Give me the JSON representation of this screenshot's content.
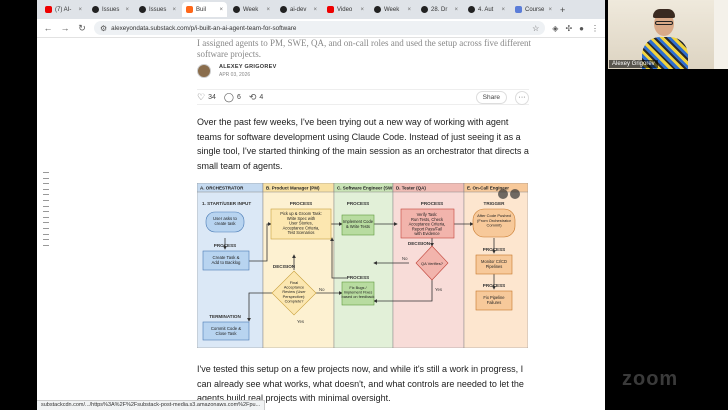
{
  "browser": {
    "tabs": [
      {
        "label": "(7) AI-",
        "icon": "youtube-icon"
      },
      {
        "label": "Issues",
        "icon": "github-icon"
      },
      {
        "label": "Issues",
        "icon": "github-icon"
      },
      {
        "label": "Buil",
        "icon": "substack-icon",
        "active": true
      },
      {
        "label": "Week",
        "icon": "github-icon"
      },
      {
        "label": "ai-dev",
        "icon": "github-icon"
      },
      {
        "label": "Video",
        "icon": "youtube-icon"
      },
      {
        "label": "Week",
        "icon": "github-icon"
      },
      {
        "label": "28. Dr",
        "icon": "github-icon"
      },
      {
        "label": "4. Aut",
        "icon": "github-icon"
      },
      {
        "label": "Course",
        "icon": "ai-icon"
      }
    ],
    "url": "alexeyondata.substack.com/p/i-built-an-ai-agent-team-for-software",
    "status_url": "substackcdn.com/.../https%3A%2F%2Fsubstack-post-media.s3.amazonaws.com%2Fpu..."
  },
  "article": {
    "faded_line_1": "I assigned agents to PM, SWE, QA, and on-call roles and used the setup across five different",
    "faded_line_2": "software projects.",
    "author_name": "ALEXEY GRIGOREV",
    "date": "APR 03, 2026",
    "likes": "34",
    "comments": "6",
    "restacks": "4",
    "share_label": "Share",
    "more_label": "···",
    "paragraph_1": "Over the past few weeks, I've been trying out a new way of working with agent teams for software development using Claude Code. Instead of just seeing it as a single tool, I've started thinking of the main session as an orchestrator that directs a small team of agents.",
    "paragraph_2": "I've tested this setup on a few projects now, and while it's still a work in progress, I can already see what works, what doesn't, and what controls are needed to let the agents build real projects with minimal oversight."
  },
  "diagram": {
    "lanes": [
      {
        "label": "A. ORCHESTRATOR",
        "color": "#dbe8f6",
        "head": "#c5daf0"
      },
      {
        "label": "B. Product Manager (PM)",
        "color": "#fdf1d1",
        "head": "#f8e1a4"
      },
      {
        "label": "C. Software Engineer (SWE)",
        "color": "#e2f0d8",
        "head": "#c9e4b6"
      },
      {
        "label": "D. Tester (QA)",
        "color": "#f8dcd8",
        "head": "#f0bcb5"
      },
      {
        "label": "E. On-Call Engineer",
        "color": "#fde6cf",
        "head": "#f7c99a"
      }
    ],
    "start_label": "1. START/USER INPUT",
    "user_asks": "User asks to create task",
    "process_label": "PROCESS",
    "create_task": "Create Task & Add to Backlog",
    "pm_task": "Pick up & Groom Task: Write Spec with User Stories, Acceptance Criteria, Test Scenarios",
    "swe_task": "Implement Code & Write Tests",
    "qa_task": "Verify Task: Run Tests, Check Acceptance Criteria, Report Pass/Fail with Evidence",
    "trigger_label": "TRIGGER",
    "trigger_task": "After Code Pushed (From Orchestrator Commit)",
    "decision_label": "DECISION",
    "pm_decision": "Final Acceptance Review (User Perspective): Complete?",
    "qa_decision": "QA Verifies?",
    "fix_task": "Fix Bugs / Implement Fixes based on feedback",
    "monitor_task": "Monitor CI/CD Pipelines",
    "fix_pipeline": "Fix Pipeline Failures",
    "termination_label": "TERMINATION",
    "commit_task": "Commit Code & Close Task",
    "yes": "Yes",
    "no": "No"
  },
  "webcam": {
    "name": "Alexey Grigorev"
  },
  "watermark": "zoom"
}
